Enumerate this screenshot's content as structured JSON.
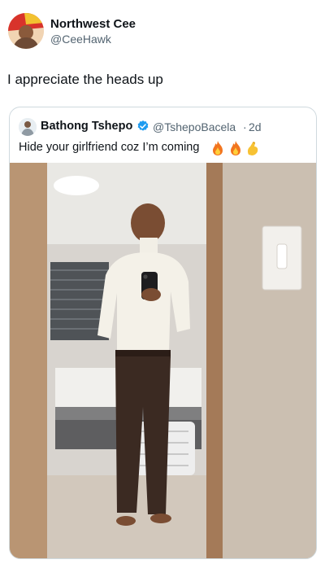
{
  "post": {
    "author_name": "Northwest Cee",
    "author_handle": "@CeeHawk",
    "text": "I appreciate the heads up"
  },
  "quoted_post": {
    "author_name": "Bathong Tshepo",
    "author_handle": "@TshepoBacela",
    "separator": "·",
    "time": "2d",
    "text": "Hide your girlfriend coz I’m coming",
    "emojis": [
      "fire-icon",
      "fire-icon",
      "pinched-fingers-icon"
    ],
    "verified_color": "#1d9bf0"
  },
  "colors": {
    "text": "#0f1419",
    "secondary_text": "#536471",
    "border": "#cfd9de"
  }
}
